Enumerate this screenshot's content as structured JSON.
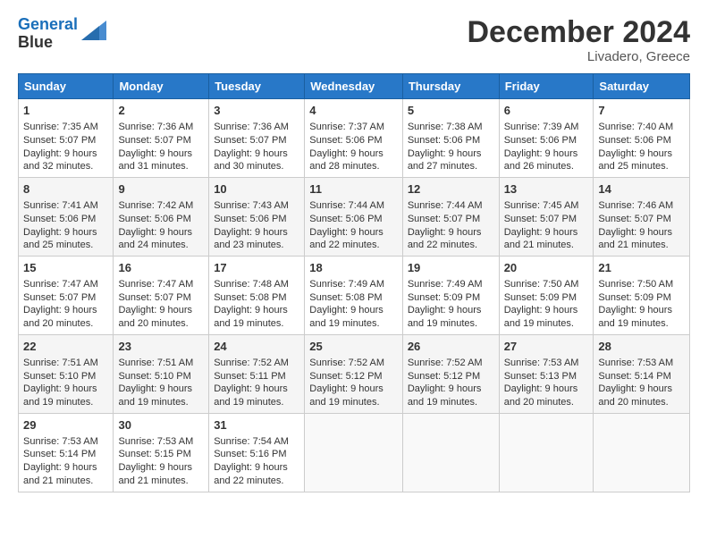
{
  "header": {
    "logo_line1": "General",
    "logo_line2": "Blue",
    "month_year": "December 2024",
    "location": "Livadero, Greece"
  },
  "columns": [
    "Sunday",
    "Monday",
    "Tuesday",
    "Wednesday",
    "Thursday",
    "Friday",
    "Saturday"
  ],
  "weeks": [
    [
      {
        "day": "1",
        "lines": [
          "Sunrise: 7:35 AM",
          "Sunset: 5:07 PM",
          "Daylight: 9 hours",
          "and 32 minutes."
        ]
      },
      {
        "day": "2",
        "lines": [
          "Sunrise: 7:36 AM",
          "Sunset: 5:07 PM",
          "Daylight: 9 hours",
          "and 31 minutes."
        ]
      },
      {
        "day": "3",
        "lines": [
          "Sunrise: 7:36 AM",
          "Sunset: 5:07 PM",
          "Daylight: 9 hours",
          "and 30 minutes."
        ]
      },
      {
        "day": "4",
        "lines": [
          "Sunrise: 7:37 AM",
          "Sunset: 5:06 PM",
          "Daylight: 9 hours",
          "and 28 minutes."
        ]
      },
      {
        "day": "5",
        "lines": [
          "Sunrise: 7:38 AM",
          "Sunset: 5:06 PM",
          "Daylight: 9 hours",
          "and 27 minutes."
        ]
      },
      {
        "day": "6",
        "lines": [
          "Sunrise: 7:39 AM",
          "Sunset: 5:06 PM",
          "Daylight: 9 hours",
          "and 26 minutes."
        ]
      },
      {
        "day": "7",
        "lines": [
          "Sunrise: 7:40 AM",
          "Sunset: 5:06 PM",
          "Daylight: 9 hours",
          "and 25 minutes."
        ]
      }
    ],
    [
      {
        "day": "8",
        "lines": [
          "Sunrise: 7:41 AM",
          "Sunset: 5:06 PM",
          "Daylight: 9 hours",
          "and 25 minutes."
        ]
      },
      {
        "day": "9",
        "lines": [
          "Sunrise: 7:42 AM",
          "Sunset: 5:06 PM",
          "Daylight: 9 hours",
          "and 24 minutes."
        ]
      },
      {
        "day": "10",
        "lines": [
          "Sunrise: 7:43 AM",
          "Sunset: 5:06 PM",
          "Daylight: 9 hours",
          "and 23 minutes."
        ]
      },
      {
        "day": "11",
        "lines": [
          "Sunrise: 7:44 AM",
          "Sunset: 5:06 PM",
          "Daylight: 9 hours",
          "and 22 minutes."
        ]
      },
      {
        "day": "12",
        "lines": [
          "Sunrise: 7:44 AM",
          "Sunset: 5:07 PM",
          "Daylight: 9 hours",
          "and 22 minutes."
        ]
      },
      {
        "day": "13",
        "lines": [
          "Sunrise: 7:45 AM",
          "Sunset: 5:07 PM",
          "Daylight: 9 hours",
          "and 21 minutes."
        ]
      },
      {
        "day": "14",
        "lines": [
          "Sunrise: 7:46 AM",
          "Sunset: 5:07 PM",
          "Daylight: 9 hours",
          "and 21 minutes."
        ]
      }
    ],
    [
      {
        "day": "15",
        "lines": [
          "Sunrise: 7:47 AM",
          "Sunset: 5:07 PM",
          "Daylight: 9 hours",
          "and 20 minutes."
        ]
      },
      {
        "day": "16",
        "lines": [
          "Sunrise: 7:47 AM",
          "Sunset: 5:07 PM",
          "Daylight: 9 hours",
          "and 20 minutes."
        ]
      },
      {
        "day": "17",
        "lines": [
          "Sunrise: 7:48 AM",
          "Sunset: 5:08 PM",
          "Daylight: 9 hours",
          "and 19 minutes."
        ]
      },
      {
        "day": "18",
        "lines": [
          "Sunrise: 7:49 AM",
          "Sunset: 5:08 PM",
          "Daylight: 9 hours",
          "and 19 minutes."
        ]
      },
      {
        "day": "19",
        "lines": [
          "Sunrise: 7:49 AM",
          "Sunset: 5:09 PM",
          "Daylight: 9 hours",
          "and 19 minutes."
        ]
      },
      {
        "day": "20",
        "lines": [
          "Sunrise: 7:50 AM",
          "Sunset: 5:09 PM",
          "Daylight: 9 hours",
          "and 19 minutes."
        ]
      },
      {
        "day": "21",
        "lines": [
          "Sunrise: 7:50 AM",
          "Sunset: 5:09 PM",
          "Daylight: 9 hours",
          "and 19 minutes."
        ]
      }
    ],
    [
      {
        "day": "22",
        "lines": [
          "Sunrise: 7:51 AM",
          "Sunset: 5:10 PM",
          "Daylight: 9 hours",
          "and 19 minutes."
        ]
      },
      {
        "day": "23",
        "lines": [
          "Sunrise: 7:51 AM",
          "Sunset: 5:10 PM",
          "Daylight: 9 hours",
          "and 19 minutes."
        ]
      },
      {
        "day": "24",
        "lines": [
          "Sunrise: 7:52 AM",
          "Sunset: 5:11 PM",
          "Daylight: 9 hours",
          "and 19 minutes."
        ]
      },
      {
        "day": "25",
        "lines": [
          "Sunrise: 7:52 AM",
          "Sunset: 5:12 PM",
          "Daylight: 9 hours",
          "and 19 minutes."
        ]
      },
      {
        "day": "26",
        "lines": [
          "Sunrise: 7:52 AM",
          "Sunset: 5:12 PM",
          "Daylight: 9 hours",
          "and 19 minutes."
        ]
      },
      {
        "day": "27",
        "lines": [
          "Sunrise: 7:53 AM",
          "Sunset: 5:13 PM",
          "Daylight: 9 hours",
          "and 20 minutes."
        ]
      },
      {
        "day": "28",
        "lines": [
          "Sunrise: 7:53 AM",
          "Sunset: 5:14 PM",
          "Daylight: 9 hours",
          "and 20 minutes."
        ]
      }
    ],
    [
      {
        "day": "29",
        "lines": [
          "Sunrise: 7:53 AM",
          "Sunset: 5:14 PM",
          "Daylight: 9 hours",
          "and 21 minutes."
        ]
      },
      {
        "day": "30",
        "lines": [
          "Sunrise: 7:53 AM",
          "Sunset: 5:15 PM",
          "Daylight: 9 hours",
          "and 21 minutes."
        ]
      },
      {
        "day": "31",
        "lines": [
          "Sunrise: 7:54 AM",
          "Sunset: 5:16 PM",
          "Daylight: 9 hours",
          "and 22 minutes."
        ]
      },
      null,
      null,
      null,
      null
    ]
  ]
}
